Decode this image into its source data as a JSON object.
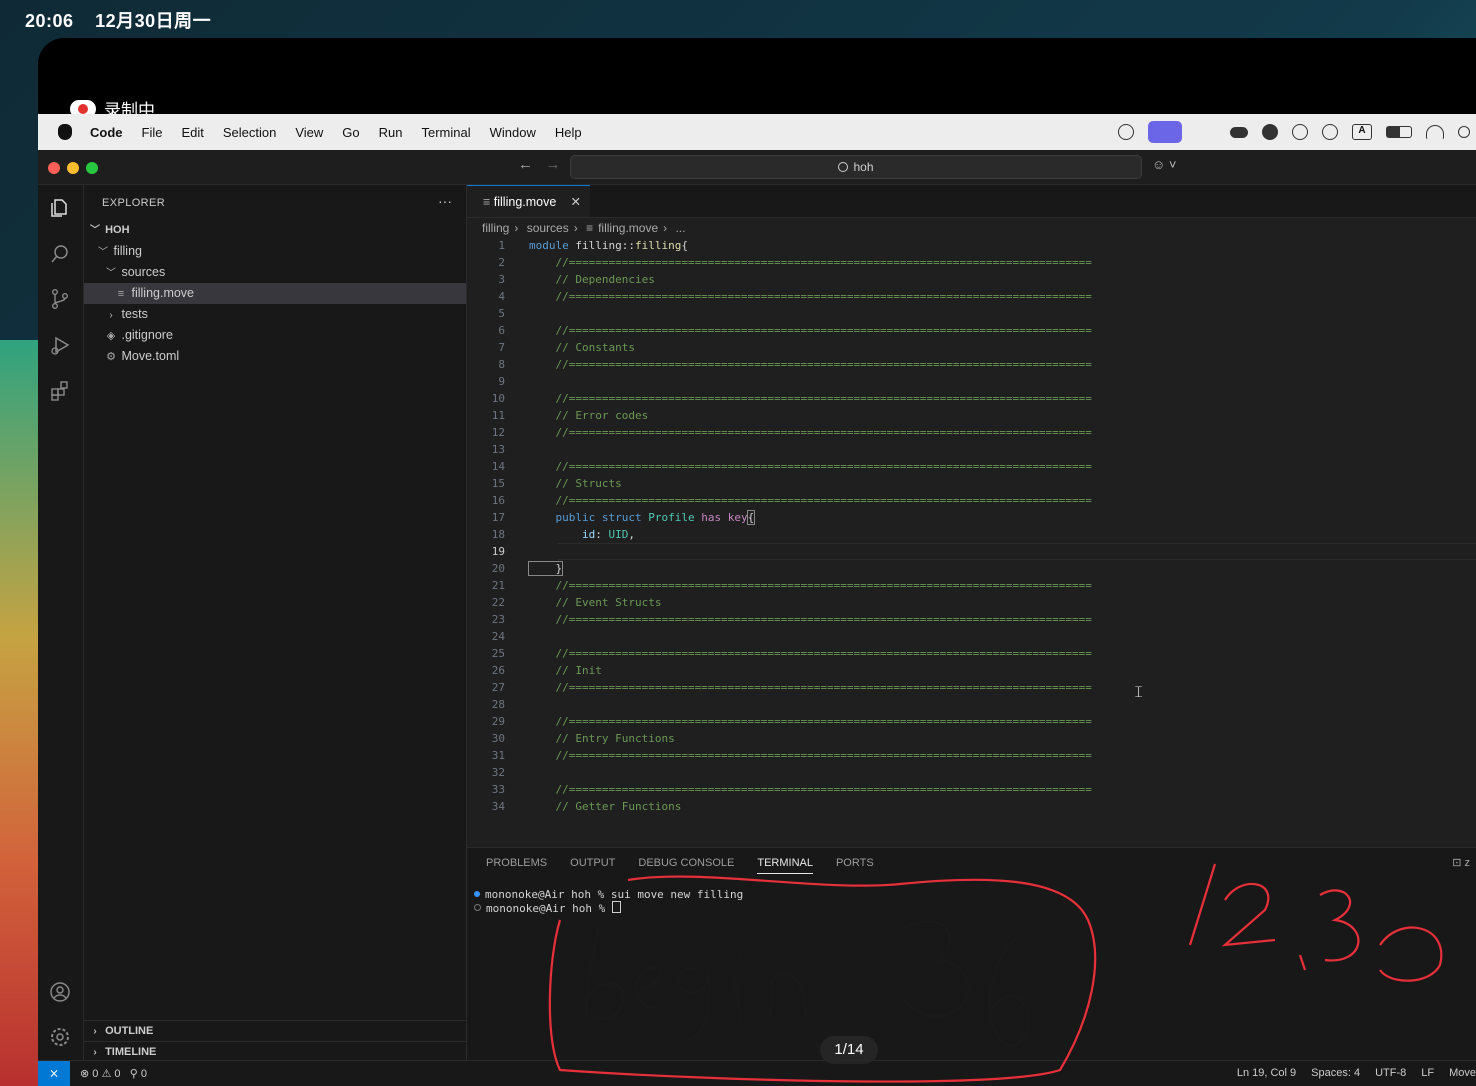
{
  "os": {
    "time": "20:06",
    "date": "12月30日周一"
  },
  "recording": {
    "label": "录制中"
  },
  "menubar": {
    "app": "Code",
    "items": [
      "File",
      "Edit",
      "Selection",
      "View",
      "Go",
      "Run",
      "Terminal",
      "Window",
      "Help"
    ],
    "tray_icons": [
      "copilot-icon",
      "screen-share-icon",
      "cloud-icon",
      "wechat-icon",
      "airdrop-icon",
      "user-icon",
      "input-method-icon",
      "battery-icon",
      "wifi-icon",
      "search-icon"
    ],
    "input_method": "A"
  },
  "titlebar": {
    "search": "hoh"
  },
  "explorer": {
    "title": "EXPLORER",
    "root": "HOH",
    "tree": [
      {
        "label": "filling",
        "kind": "folder-open",
        "depth": 1
      },
      {
        "label": "sources",
        "kind": "folder-open",
        "depth": 2
      },
      {
        "label": "filling.move",
        "kind": "file",
        "depth": 3,
        "selected": true
      },
      {
        "label": "tests",
        "kind": "folder-closed",
        "depth": 2
      },
      {
        "label": ".gitignore",
        "kind": "file",
        "depth": 2
      },
      {
        "label": "Move.toml",
        "kind": "file",
        "depth": 2
      }
    ],
    "outline": "OUTLINE",
    "timeline": "TIMELINE"
  },
  "editor": {
    "tab": "filling.move",
    "breadcrumb": [
      "filling",
      "sources",
      "filling.move",
      "..."
    ],
    "current_line": 19,
    "lines": [
      [
        {
          "c": "kw",
          "t": "module "
        },
        {
          "c": "pl",
          "t": "filling::"
        },
        {
          "c": "fn",
          "t": "filling"
        },
        {
          "c": "pl",
          "t": "{"
        }
      ],
      [
        {
          "c": "cmt",
          "t": "    //==============================================================================="
        }
      ],
      [
        {
          "c": "cmt",
          "t": "    // Dependencies"
        }
      ],
      [
        {
          "c": "cmt",
          "t": "    //==============================================================================="
        }
      ],
      [],
      [
        {
          "c": "cmt",
          "t": "    //==============================================================================="
        }
      ],
      [
        {
          "c": "cmt",
          "t": "    // Constants"
        }
      ],
      [
        {
          "c": "cmt",
          "t": "    //==============================================================================="
        }
      ],
      [],
      [
        {
          "c": "cmt",
          "t": "    //==============================================================================="
        }
      ],
      [
        {
          "c": "cmt",
          "t": "    // Error codes"
        }
      ],
      [
        {
          "c": "cmt",
          "t": "    //==============================================================================="
        }
      ],
      [],
      [
        {
          "c": "cmt",
          "t": "    //==============================================================================="
        }
      ],
      [
        {
          "c": "cmt",
          "t": "    // Structs"
        }
      ],
      [
        {
          "c": "cmt",
          "t": "    //==============================================================================="
        }
      ],
      [
        {
          "c": "kw",
          "t": "    public "
        },
        {
          "c": "kw",
          "t": "struct "
        },
        {
          "c": "ty",
          "t": "Profile "
        },
        {
          "c": "kw2",
          "t": "has "
        },
        {
          "c": "kw2",
          "t": "key"
        },
        {
          "c": "pl brk",
          "t": "{"
        }
      ],
      [
        {
          "c": "id",
          "t": "        id"
        },
        {
          "c": "pl",
          "t": ": "
        },
        {
          "c": "ty",
          "t": "UID"
        },
        {
          "c": "pl",
          "t": ","
        }
      ],
      [
        {
          "c": "pl",
          "t": "        "
        }
      ],
      [
        {
          "c": "pl brk",
          "t": "    }"
        }
      ],
      [
        {
          "c": "cmt",
          "t": "    //==============================================================================="
        }
      ],
      [
        {
          "c": "cmt",
          "t": "    // Event Structs"
        }
      ],
      [
        {
          "c": "cmt",
          "t": "    //==============================================================================="
        }
      ],
      [],
      [
        {
          "c": "cmt",
          "t": "    //==============================================================================="
        }
      ],
      [
        {
          "c": "cmt",
          "t": "    // Init"
        }
      ],
      [
        {
          "c": "cmt",
          "t": "    //==============================================================================="
        }
      ],
      [],
      [
        {
          "c": "cmt",
          "t": "    //==============================================================================="
        }
      ],
      [
        {
          "c": "cmt",
          "t": "    // Entry Functions"
        }
      ],
      [
        {
          "c": "cmt",
          "t": "    //==============================================================================="
        }
      ],
      [],
      [
        {
          "c": "cmt",
          "t": "    //==============================================================================="
        }
      ],
      [
        {
          "c": "cmt",
          "t": "    // Getter Functions"
        }
      ]
    ]
  },
  "panel": {
    "tabs": [
      "PROBLEMS",
      "OUTPUT",
      "DEBUG CONSOLE",
      "TERMINAL",
      "PORTS"
    ],
    "active": "TERMINAL",
    "terminal_icon_label": "z",
    "terminal": [
      "mononoke@Air hoh % sui move new filling",
      "mononoke@Air hoh % "
    ]
  },
  "statusbar": {
    "errors": "0",
    "warnings": "0",
    "ports": "0",
    "position": "Ln 19, Col 9",
    "spaces": "Spaces: 4",
    "encoding": "UTF-8",
    "eol": "LF",
    "language": "Move"
  },
  "annotation": {
    "text": "begin36",
    "date": "12.30",
    "color": "#e8303a"
  },
  "pager": {
    "label": "1/14"
  }
}
